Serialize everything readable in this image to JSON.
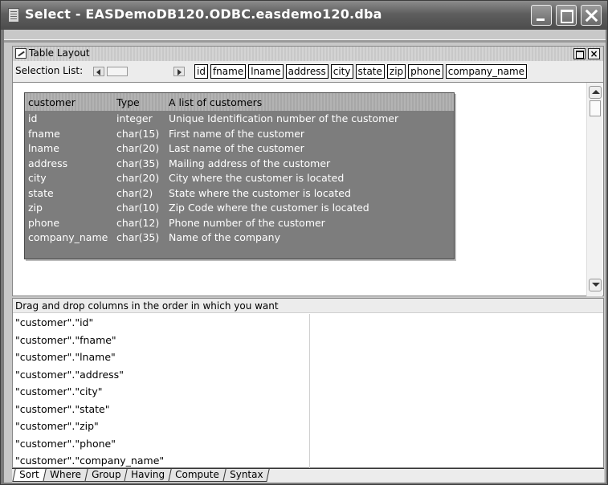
{
  "window": {
    "title": "Select - EASDemoDB120.ODBC.easdemo120.dba"
  },
  "child_window": {
    "title": "Table Layout",
    "selection_label": "Selection List:",
    "selection_columns": [
      "id",
      "fname",
      "lname",
      "address",
      "city",
      "state",
      "zip",
      "phone",
      "company_name"
    ]
  },
  "table": {
    "header": {
      "name": "customer",
      "type": "Type",
      "comment": "A list of customers"
    },
    "rows": [
      {
        "name": "id",
        "type": "integer",
        "comment": "Unique Identification number of the customer"
      },
      {
        "name": "fname",
        "type": "char(15)",
        "comment": "First name of the customer"
      },
      {
        "name": "lname",
        "type": "char(20)",
        "comment": "Last name of the customer"
      },
      {
        "name": "address",
        "type": "char(35)",
        "comment": "Mailing address of the customer"
      },
      {
        "name": "city",
        "type": "char(20)",
        "comment": "City where the customer is located"
      },
      {
        "name": "state",
        "type": "char(2)",
        "comment": "State where the customer is located"
      },
      {
        "name": "zip",
        "type": "char(10)",
        "comment": "Zip Code where the customer is located"
      },
      {
        "name": "phone",
        "type": "char(12)",
        "comment": "Phone number of the customer"
      },
      {
        "name": "company_name",
        "type": "char(35)",
        "comment": "Name of the company"
      }
    ]
  },
  "sort": {
    "instruction": "Drag and drop columns in the order in which you want",
    "items": [
      "\"customer\".\"id\"",
      "\"customer\".\"fname\"",
      "\"customer\".\"lname\"",
      "\"customer\".\"address\"",
      "\"customer\".\"city\"",
      "\"customer\".\"state\"",
      "\"customer\".\"zip\"",
      "\"customer\".\"phone\"",
      "\"customer\".\"company_name\""
    ]
  },
  "tabs": [
    "Sort",
    "Where",
    "Group",
    "Having",
    "Compute",
    "Syntax"
  ]
}
